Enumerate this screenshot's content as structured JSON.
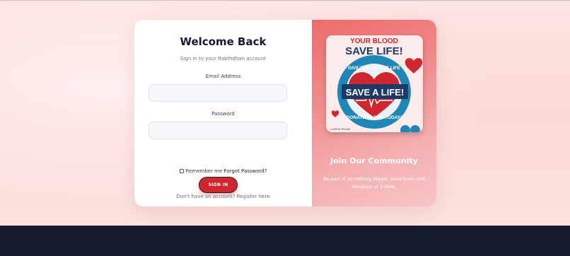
{
  "login": {
    "title": "Welcome Back",
    "subtitle": "Sign in to your Rakthdhan account",
    "email_label": "Email Address",
    "email_value": "",
    "password_label": "Password",
    "password_value": "",
    "remember_label": "Remember me",
    "remember_checked": false,
    "forgot_link": "Forgot Password?",
    "signin_button": "SIGN IN",
    "register_text": "Don't have an account? Register here"
  },
  "promo": {
    "poster_title_top": "YOUR BLOOD",
    "poster_title_main": "SAVE LIFE!",
    "poster_ring_top": "GIVE THE GIFT OF LIFE",
    "poster_banner": "SAVE A LIFE!",
    "poster_ring_bottom": "DONATE BLOOD TODAY!",
    "poster_corner": "LOREM IPSUM",
    "title": "Join Our Community",
    "text": "Be part of something bigger. Save lives, one donation at a time."
  },
  "colors": {
    "accent": "#d0262f",
    "panel_gradient_start": "#ef6b6b",
    "footer": "#141a2c",
    "heading": "#151a2e"
  },
  "icons": {
    "heart": "heart-icon",
    "checkbox": "checkbox-icon"
  }
}
